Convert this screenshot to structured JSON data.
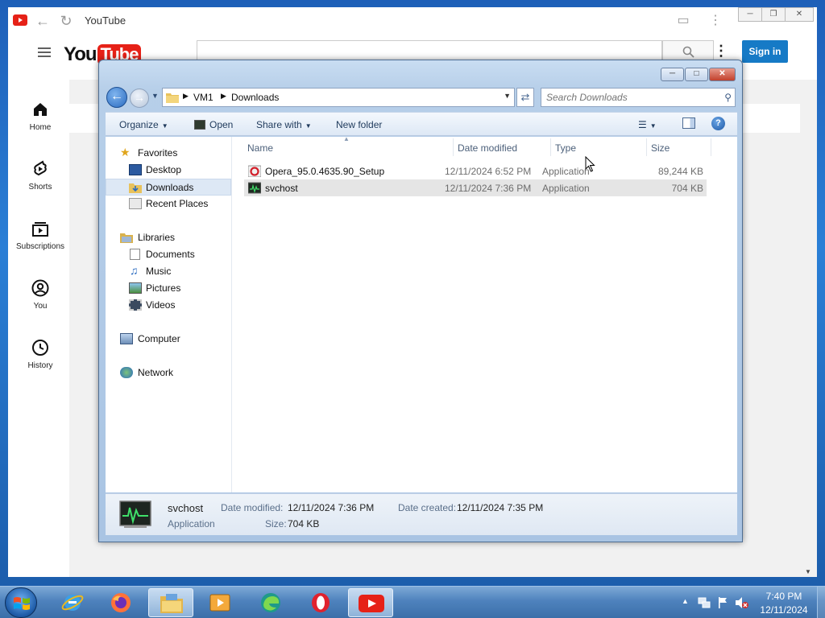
{
  "browser": {
    "app_title": "YouTube",
    "search_placeholder": "",
    "signin_label": "Sign in",
    "logo_you": "You",
    "logo_tube": "Tube",
    "sidebar": [
      {
        "label": "Home",
        "icon": "home-icon"
      },
      {
        "label": "Shorts",
        "icon": "shorts-icon"
      },
      {
        "label": "Subscriptions",
        "icon": "subscriptions-icon"
      },
      {
        "label": "You",
        "icon": "account-icon"
      },
      {
        "label": "History",
        "icon": "history-icon"
      }
    ]
  },
  "explorer": {
    "breadcrumb": [
      "VM1",
      "Downloads"
    ],
    "search_placeholder": "Search Downloads",
    "toolbar": {
      "organize": "Organize",
      "open": "Open",
      "share_with": "Share with",
      "new_folder": "New folder"
    },
    "nav_pane": [
      {
        "label": "Favorites",
        "icon": "star-icon",
        "group": true
      },
      {
        "label": "Desktop",
        "icon": "desktop-icon"
      },
      {
        "label": "Downloads",
        "icon": "downloads-folder-icon",
        "selected": true
      },
      {
        "label": "Recent Places",
        "icon": "recent-places-icon"
      },
      {
        "label": "Libraries",
        "icon": "libraries-icon",
        "group": true
      },
      {
        "label": "Documents",
        "icon": "documents-icon"
      },
      {
        "label": "Music",
        "icon": "music-icon"
      },
      {
        "label": "Pictures",
        "icon": "pictures-icon"
      },
      {
        "label": "Videos",
        "icon": "videos-icon"
      },
      {
        "label": "Computer",
        "icon": "computer-icon",
        "group": true
      },
      {
        "label": "Network",
        "icon": "network-icon",
        "group": true
      }
    ],
    "columns": {
      "name": "Name",
      "date": "Date modified",
      "type": "Type",
      "size": "Size"
    },
    "files": [
      {
        "name": "Opera_95.0.4635.90_Setup",
        "date": "12/11/2024 6:52 PM",
        "type": "Application",
        "size": "89,244 KB",
        "icon": "opera-installer-icon"
      },
      {
        "name": "svchost",
        "date": "12/11/2024 7:36 PM",
        "type": "Application",
        "size": "704 KB",
        "icon": "svchost-app-icon",
        "selected": true
      }
    ],
    "details": {
      "name": "svchost",
      "type": "Application",
      "date_modified_label": "Date modified:",
      "date_modified": "12/11/2024 7:36 PM",
      "size_label": "Size:",
      "size": "704 KB",
      "date_created_label": "Date created:",
      "date_created": "12/11/2024 7:35 PM"
    }
  },
  "taskbar": {
    "apps": [
      "internet-explorer-icon",
      "firefox-icon",
      "file-explorer-icon",
      "media-player-icon",
      "edge-icon",
      "opera-icon",
      "youtube-icon"
    ],
    "time": "7:40 PM",
    "date": "12/11/2024"
  },
  "colors": {
    "youtube_red": "#e62117",
    "signin_blue": "#167ac6",
    "selection": "#e5e5e5"
  }
}
